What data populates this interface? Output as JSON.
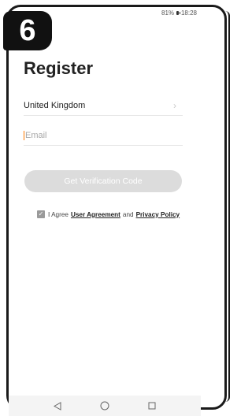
{
  "step": {
    "number": "6"
  },
  "status_bar": {
    "battery": "81%",
    "time": "18:28"
  },
  "page": {
    "title": "Register"
  },
  "country": {
    "value": "United Kingdom"
  },
  "email": {
    "placeholder": "Email",
    "value": ""
  },
  "verify_button": {
    "label": "Get Verification Code"
  },
  "agreement": {
    "prefix": "I Agree",
    "user_agreement": "User Agreement",
    "conjunction": "and",
    "privacy_policy": "Privacy Policy",
    "checked": true
  },
  "colors": {
    "cursor": "#ff7a00",
    "button_disabled": "#dcdcdc",
    "checkbox": "#9a9a9a"
  },
  "nav": {
    "icons": [
      "back-triangle-icon",
      "home-circle-icon",
      "recents-square-icon"
    ]
  }
}
